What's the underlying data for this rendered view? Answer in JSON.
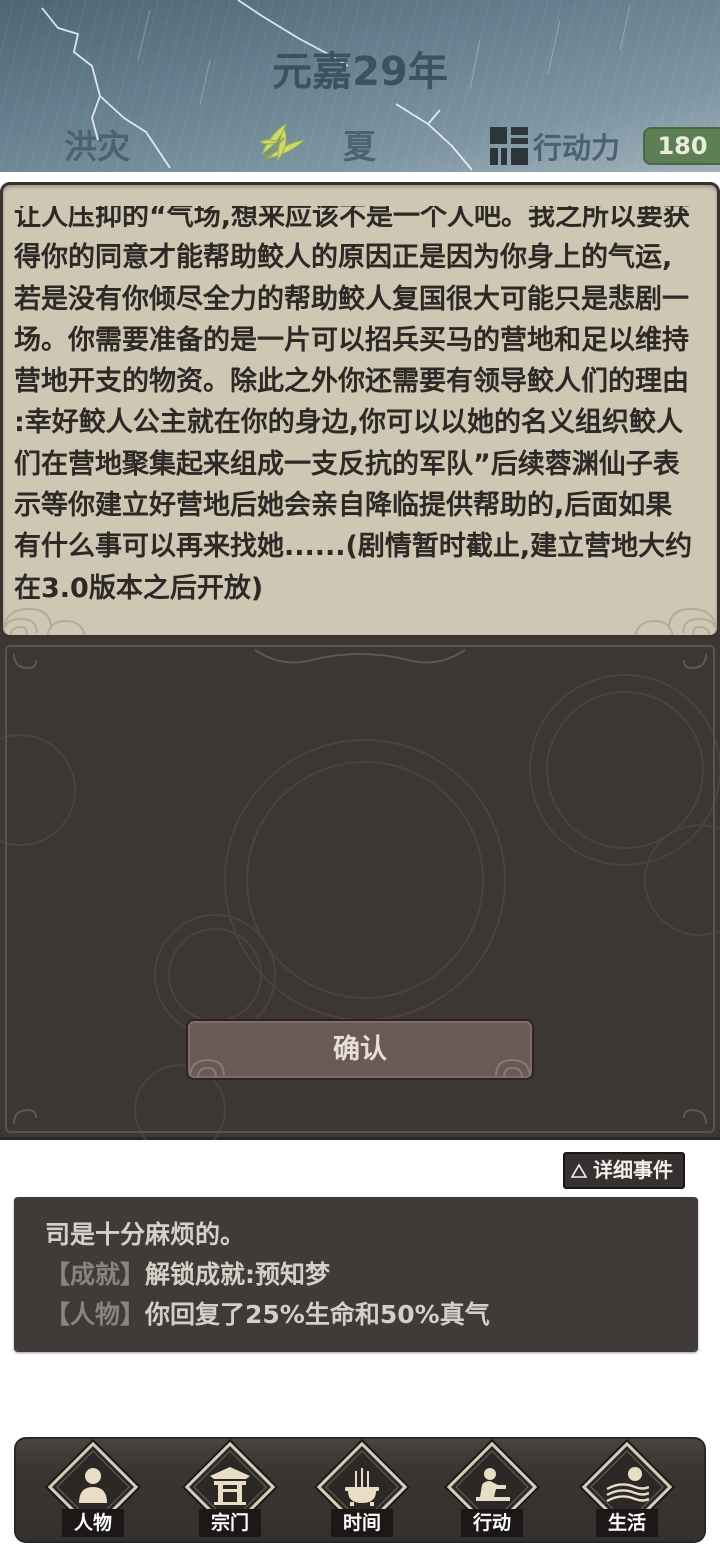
{
  "header": {
    "year_title": "元嘉29年",
    "disaster": "洪灾",
    "season": "夏",
    "season_icon": "bamboo-leaf-icon",
    "action_icon": "action-power-icon",
    "action_label": "行动力",
    "action_points": "180"
  },
  "dialog": {
    "lines": [
      "让人压抑的“气场,想来应该不是一个人吧。我之所以要获",
      "得你的同意才能帮助鲛人的原因正是因为你身上的气运,",
      "若是没有你倾尽全力的帮助鲛人复国很大可能只是悲剧一",
      "场。你需要准备的是一片可以招兵买马的营地和足以维持",
      "营地开支的物资。除此之外你还需要有领导鲛人们的理由",
      ":幸好鲛人公主就在你的身边,你可以以她的名义组织鲛人",
      "们在营地聚集起来组成一支反抗的军队”后续蓉渊仙子表",
      "示等你建立好营地后她会亲自降临提供帮助的,后面如果",
      "有什么事可以再来找她......(剧情暂时截止,建立营地大约",
      "在3.0版本之后开放)"
    ]
  },
  "confirm_button": {
    "label": "确认"
  },
  "detail_button": {
    "icon": "triangle-up-icon",
    "label": "详细事件"
  },
  "log": {
    "lines": [
      {
        "text": "司是十分麻烦的。"
      },
      {
        "tag": "【成就】",
        "text": "解锁成就:预知梦"
      },
      {
        "tag": "【人物】",
        "text": "你回复了25%生命和50%真气"
      }
    ]
  },
  "nav": [
    {
      "label": "人物",
      "icon": "person-icon"
    },
    {
      "label": "宗门",
      "icon": "sect-gate-icon"
    },
    {
      "label": "时间",
      "icon": "incense-burner-icon"
    },
    {
      "label": "行动",
      "icon": "action-icon"
    },
    {
      "label": "生活",
      "icon": "sun-field-icon"
    }
  ],
  "colors": {
    "header_sky": "#66808f",
    "parchment": "#cdc7b3",
    "dark_panel": "#3d3734",
    "confirm_button": "#6a5a56",
    "action_badge": "#5e7e56",
    "log_tag": "#8b837d"
  }
}
